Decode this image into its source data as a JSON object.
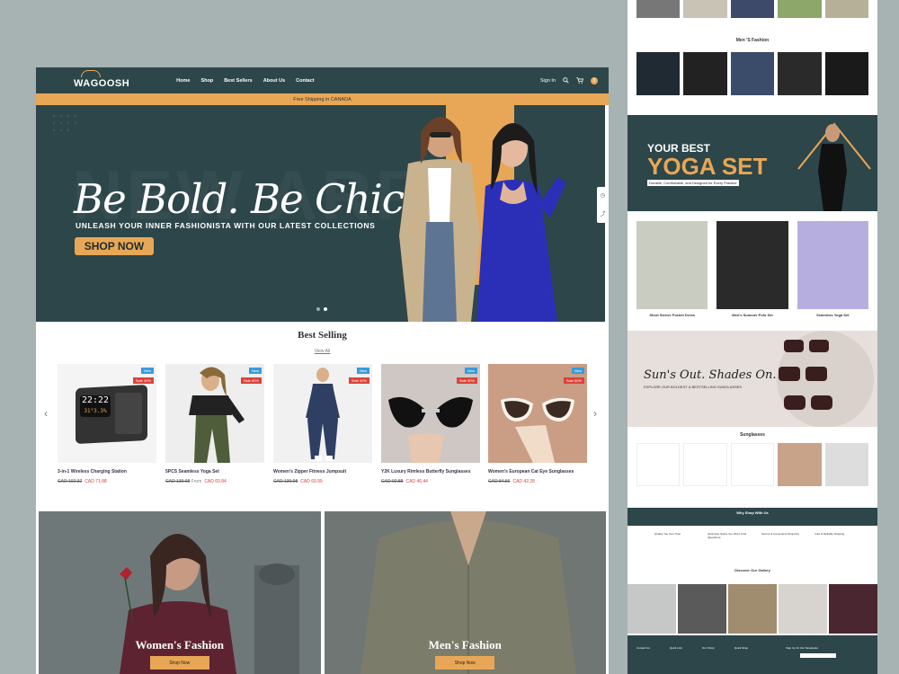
{
  "brand": {
    "logo": "WAGOOSH"
  },
  "nav": {
    "links": [
      "Home",
      "Shop",
      "Best Sellers",
      "About Us",
      "Contact"
    ],
    "sign_in": "Sign In",
    "cart_count": "0"
  },
  "promo": "Free Shipping in CANADA",
  "hero": {
    "bg_text": "NEW ARR",
    "title": "Be Bold. Be Chic.",
    "subtitle": "UNLEASH YOUR INNER FASHIONISTA WITH OUR LATEST COLLECTIONS",
    "cta": "SHOP NOW"
  },
  "best_selling": {
    "title": "Best Selling",
    "view_all": "View All",
    "products": [
      {
        "name": "3-in-1 Wireless Charging Station",
        "old": "CAD 102.32",
        "new": "CAD 71.88",
        "badge_new": "New",
        "badge_sale": "Sale 30%",
        "clock": "22:22",
        "clock2": "31°3.3%"
      },
      {
        "name": "5PCS Seamless Yoga Set",
        "old": "CAD 139.68",
        "from": "From",
        "new": "CAD 69.84",
        "badge_new": "New",
        "badge_sale": "Sale 50%"
      },
      {
        "name": "Women's Zipper Fitness Jumpsuit",
        "old": "CAD 139.98",
        "new": "CAD 69.99",
        "badge_new": "New",
        "badge_sale": "Sale 50%"
      },
      {
        "name": "Y2K Luxury Rimless Butterfly Sunglasses",
        "old": "CAD 92.88",
        "new": "CAD 46.44",
        "badge_new": "New",
        "badge_sale": "Sale 50%"
      },
      {
        "name": "Women's European Cat Eye Sunglasses",
        "old": "CAD 84.56",
        "new": "CAD 42.28",
        "badge_new": "New",
        "badge_sale": "Sale 50%"
      }
    ]
  },
  "categories": [
    {
      "label": "Women's Fashion",
      "button": "Shop Now"
    },
    {
      "label": "Men's Fashion",
      "button": "Shop Now"
    }
  ],
  "side": {
    "mens_title": "Men 'S Fashion",
    "yoga_pre": "YOUR BEST",
    "yoga_title": "YOGA SET",
    "yoga_sub": "Durable, Comfortable, and Designed for Every Practice",
    "looks": [
      "Short Sleeve Pocket Dress",
      "Men's Summer Polo Set",
      "Seamless Yoga Set"
    ],
    "shades_title": "Sun's Out. Shades On.",
    "shades_sub": "EXPLORE OUR BOLDEST & BESTSELLING SUNGLASSES",
    "sunglasses_title": "Sunglasses",
    "why_title": "Why Shop With Us",
    "features": [
      "Quality You Can Trust",
      "Exclusive Styles You Won't Find Elsewhere",
      "Secure & Convenient Shopping",
      "Fast & Reliable Shipping"
    ],
    "gallery_title": "Discover Our Gallery",
    "footer_cols": [
      "Contact Us",
      "Quick Link",
      "Our Policy",
      "Quick Shop"
    ],
    "newsletter": "Sign Up for Our Newsletter"
  },
  "colors": {
    "primary": "#2d4649",
    "accent": "#e8a756",
    "sale": "#d9433a",
    "new": "#3a9ad9"
  }
}
